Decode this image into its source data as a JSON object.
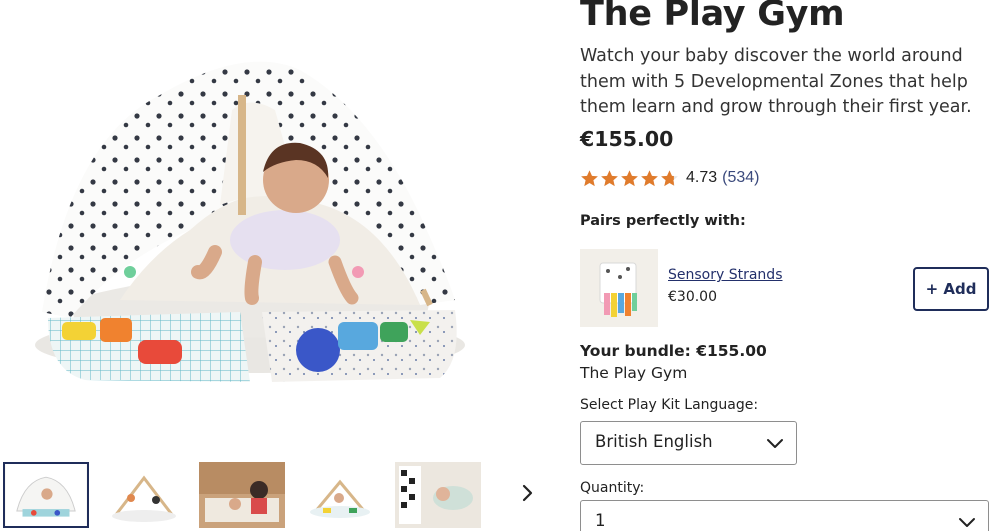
{
  "product": {
    "title": "The Play Gym",
    "description": "Watch your baby discover the world around them with 5 Developmental Zones that help them learn and grow through their first year.",
    "price": "€155.00",
    "rating": {
      "stars_filled": 4.73,
      "stars_total": 5,
      "value": "4.73",
      "count": "(534)",
      "star_color": "#e07b2c"
    }
  },
  "gallery": {
    "thumbnail_count": 5,
    "active_index": 0,
    "next_icon": "chevron-right-icon"
  },
  "pairs": {
    "heading": "Pairs perfectly with:",
    "item": {
      "name": "Sensory Strands",
      "price": "€30.00",
      "add_label": "+ Add"
    }
  },
  "bundle": {
    "label": "Your bundle: €155.00",
    "item": "The Play Gym"
  },
  "options": {
    "language_label": "Select Play Kit Language:",
    "language_value": "British English",
    "quantity_label": "Quantity:",
    "quantity_value": "1"
  },
  "colors": {
    "accent_navy": "#1f2d5a",
    "link": "#23306b"
  }
}
